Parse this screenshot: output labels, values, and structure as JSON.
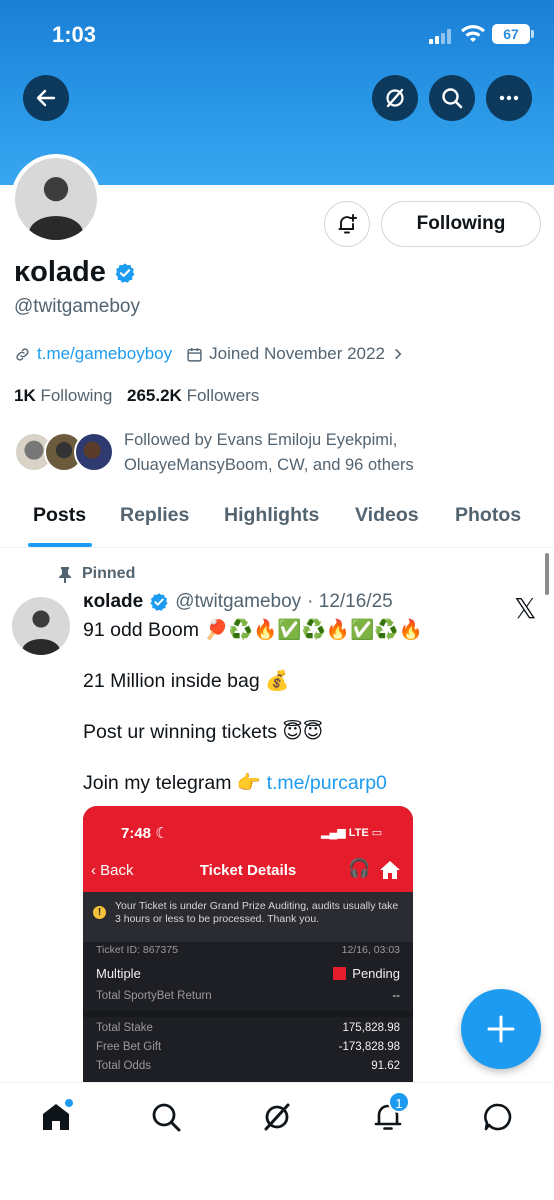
{
  "status_bar": {
    "time": "1:03",
    "battery": "67"
  },
  "header": {
    "back_icon": "arrow-left-icon",
    "grok_icon": "grok-icon",
    "search_icon": "search-icon",
    "more_icon": "more-horizontal-icon"
  },
  "profile": {
    "display_name": "ĸolade",
    "handle": "@twitgameboy",
    "link": "t.me/gameboyboy",
    "joined": "Joined November 2022",
    "following_count": "1K",
    "following_label": "Following",
    "followers_count": "265.2K",
    "followers_label": "Followers",
    "followed_by": "Followed by Evans Emiloju Eyekpimi, OluayeMansyBoom, CW, and 96 others",
    "follow_button": "Following"
  },
  "tabs": [
    "Posts",
    "Replies",
    "Highlights",
    "Videos",
    "Photos"
  ],
  "post": {
    "pinned_label": "Pinned",
    "author_name": "ĸolade",
    "author_handle": "@twitgameboy",
    "date": "· 12/16/25",
    "line1": "91 odd Boom 🏓♻️🔥✅♻️🔥✅♻️🔥",
    "line2": "21 Million inside bag 💰",
    "line3": "Post ur winning tickets 😇😇",
    "line4_prefix": "Join my telegram 👉 ",
    "line4_link": "t.me/purcarp0"
  },
  "ticket": {
    "time": "7:48",
    "network": "LTE",
    "back": "Back",
    "title": "Ticket Details",
    "notice": "Your Ticket is under Grand Prize Auditing, audits usually take 3 hours or less to be processed. Thank you.",
    "ticket_id": "Ticket ID: 867375",
    "ticket_date": "12/16, 03:03",
    "type": "Multiple",
    "status": "Pending",
    "return_label": "Total SportyBet Return",
    "return_value": "--",
    "rows": [
      {
        "label": "Total Stake",
        "value": "175,828.98"
      },
      {
        "label": "Free Bet Gift",
        "value": "-173,828.98"
      },
      {
        "label": "Total Odds",
        "value": "91.62"
      }
    ]
  },
  "bottom_nav": {
    "notification_count": "1"
  },
  "colors": {
    "accent": "#1d9bf0",
    "banner": "#2996e6",
    "ticket_red": "#e41c2c"
  }
}
